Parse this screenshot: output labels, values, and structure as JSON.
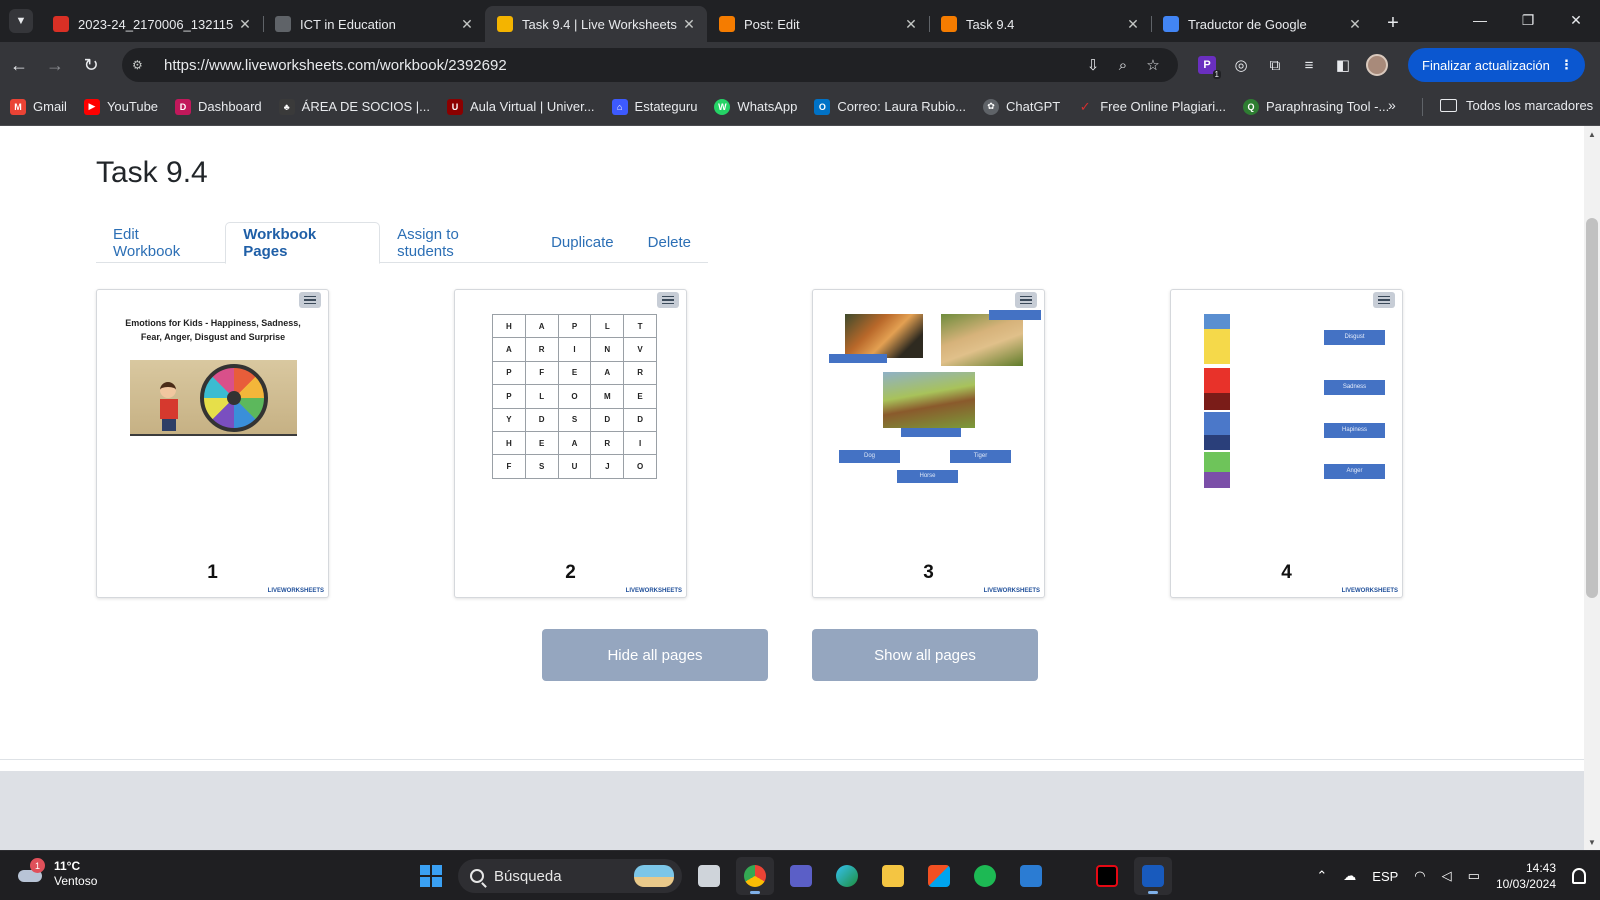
{
  "browser": {
    "tabs": [
      {
        "title": "2023-24_2170006_132115",
        "favicon_color": "#d93025",
        "favicon_glyph": "▼",
        "active": false
      },
      {
        "title": "ICT in Education",
        "favicon_color": "#5f6368",
        "favicon_glyph": "◎",
        "active": false
      },
      {
        "title": "Task 9.4 | Live Worksheets",
        "favicon_color": "#f4b400",
        "favicon_glyph": "LW",
        "active": true
      },
      {
        "title": "Post: Edit",
        "favicon_color": "#f57c00",
        "favicon_glyph": "B",
        "active": false
      },
      {
        "title": "Task 9.4",
        "favicon_color": "#f57c00",
        "favicon_glyph": "B",
        "active": false
      },
      {
        "title": "Traductor de Google",
        "favicon_color": "#4285f4",
        "favicon_glyph": "G",
        "active": false
      }
    ],
    "url": "https://www.liveworksheets.com/workbook/2392692",
    "update_button": "Finalizar actualización",
    "extension_badge": "1",
    "bookmarks": [
      {
        "label": "Gmail",
        "color": "#ea4335",
        "glyph": "M"
      },
      {
        "label": "YouTube",
        "color": "#ff0000",
        "glyph": "▶"
      },
      {
        "label": "Dashboard",
        "color": "#c2185b",
        "glyph": "D"
      },
      {
        "label": "ÁREA DE SOCIOS |...",
        "color": "#3a3a3a",
        "glyph": "♣"
      },
      {
        "label": "Aula Virtual | Univer...",
        "color": "#8b0000",
        "glyph": "U"
      },
      {
        "label": "Estateguru",
        "color": "#3d5afe",
        "glyph": "⌂"
      },
      {
        "label": "WhatsApp",
        "color": "#25d366",
        "glyph": "W"
      },
      {
        "label": "Correo: Laura Rubio...",
        "color": "#0072c6",
        "glyph": "O"
      },
      {
        "label": "ChatGPT",
        "color": "#5f6368",
        "glyph": "✿"
      },
      {
        "label": "Free Online Plagiari...",
        "color": "#d32f2f",
        "glyph": "✓"
      },
      {
        "label": "Paraphrasing Tool -...",
        "color": "#2e7d32",
        "glyph": "Q"
      }
    ],
    "all_bookmarks": "Todos los marcadores"
  },
  "page": {
    "title": "Task 9.4",
    "tabs": [
      "Edit Workbook",
      "Workbook Pages",
      "Assign to students",
      "Duplicate",
      "Delete"
    ],
    "active_tab": "Workbook Pages",
    "brand": "LIVEWORKSHEETS",
    "cards": [
      {
        "number": "1",
        "title": "Emotions for Kids - Happiness, Sadness, Fear, Anger, Disgust and Surprise"
      },
      {
        "number": "2",
        "grid": [
          [
            "H",
            "A",
            "P",
            "L",
            "T"
          ],
          [
            "A",
            "R",
            "I",
            "N",
            "V"
          ],
          [
            "P",
            "F",
            "E",
            "A",
            "R"
          ],
          [
            "P",
            "L",
            "O",
            "M",
            "E"
          ],
          [
            "Y",
            "D",
            "S",
            "D",
            "D"
          ],
          [
            "H",
            "E",
            "A",
            "R",
            "I"
          ],
          [
            "F",
            "S",
            "U",
            "J",
            "O"
          ]
        ]
      },
      {
        "number": "3",
        "labels": [
          "Dog",
          "Tiger",
          "Horse"
        ]
      },
      {
        "number": "4",
        "labels": [
          "Disgust",
          "Sadness",
          "Hapiness",
          "Anger"
        ]
      }
    ],
    "hide_button": "Hide all pages",
    "show_button": "Show all pages"
  },
  "taskbar": {
    "weather_badge": "1",
    "temperature": "11°C",
    "condition": "Ventoso",
    "search_placeholder": "Búsqueda",
    "language": "ESP",
    "time": "14:43",
    "date": "10/03/2024"
  }
}
